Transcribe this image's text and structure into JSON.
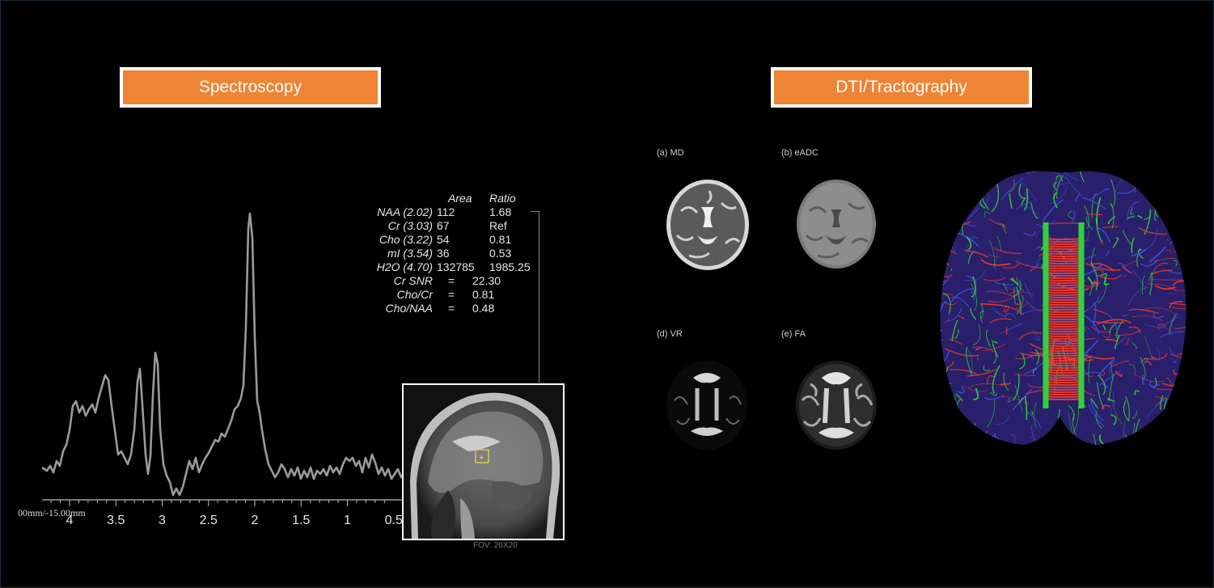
{
  "headers": {
    "spectroscopy": "Spectroscopy",
    "dti": "DTI/Tractography"
  },
  "spectrum": {
    "axis_ticks": [
      "4",
      "3.5",
      "3",
      "2.5",
      "2",
      "1.5",
      "1",
      "0.5"
    ],
    "axis_left_text": "00mm/-15.00mm"
  },
  "metabolites": {
    "header_area": "Area",
    "header_ratio": "Ratio",
    "rows": [
      {
        "name": "NAA (2.02)",
        "area": "112",
        "ratio": "1.68"
      },
      {
        "name": "Cr (3.03)",
        "area": "67",
        "ratio": "Ref"
      },
      {
        "name": "Cho (3.22)",
        "area": "54",
        "ratio": "0.81"
      },
      {
        "name": "mI (3.54)",
        "area": "36",
        "ratio": "0.53"
      },
      {
        "name": "H2O (4.70)",
        "area": "132785",
        "ratio": "1985.25"
      }
    ],
    "stats": [
      {
        "name": "Cr SNR",
        "eq": "=",
        "value": "22.30"
      },
      {
        "name": "Cho/Cr",
        "eq": "=",
        "value": "0.81"
      },
      {
        "name": "Cho/NAA",
        "eq": "=",
        "value": "0.48"
      }
    ]
  },
  "mri_caption": "FOV: 20X20",
  "dti_panels": [
    {
      "label": "(a) MD"
    },
    {
      "label": "(b) eADC"
    },
    {
      "label": "(d) VR"
    },
    {
      "label": "(e) FA"
    }
  ],
  "colors": {
    "header_bg": "#ee8434",
    "spectrum_line": "#9a9a9a",
    "tract_red": "#e83a2e",
    "tract_green": "#30d23a",
    "tract_blue": "#3a4fe0"
  }
}
